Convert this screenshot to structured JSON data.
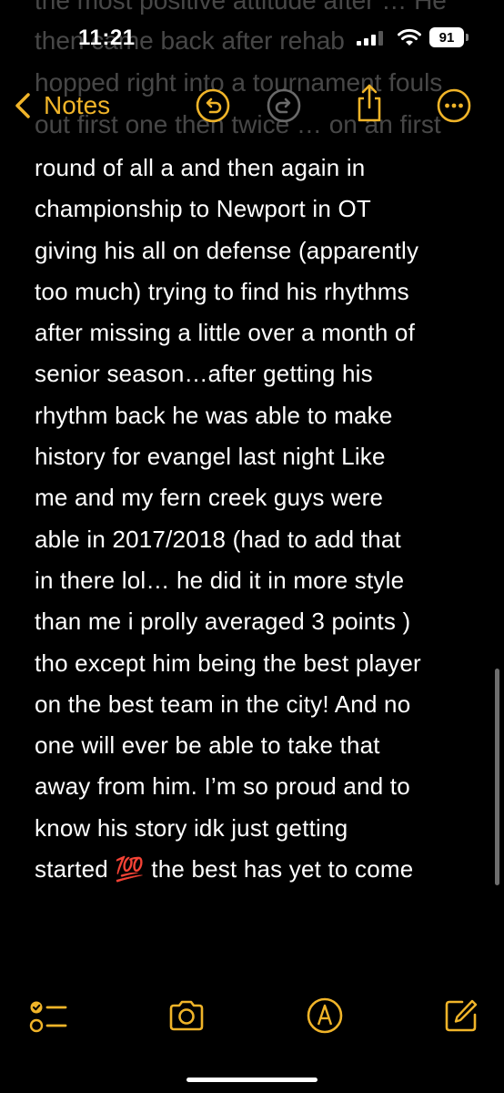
{
  "status_bar": {
    "time": "11:21",
    "battery_level": "91",
    "icons": [
      "signal-icon",
      "wifi-icon",
      "battery-icon"
    ]
  },
  "background_text": {
    "lines": [
      "the most positive attitude after … He",
      "then came back after rehab",
      "hopped right into a tournament fouls",
      "out first one then twice … on an first"
    ]
  },
  "nav": {
    "back_label": "Notes",
    "accent_color": "#f0b429",
    "icons": [
      "chevron-left-icon",
      "undo-icon",
      "redo-icon",
      "share-icon",
      "more-icon"
    ]
  },
  "note": {
    "lines": [
      "round of all a and then again in",
      "championship to Newport in OT",
      "giving his all on defense (apparently",
      "too much) trying to find his rhythms",
      "after missing a little over a month of",
      "senior season…after getting his",
      "rhythm back he was able to make",
      "history for evangel last night Like",
      "me and my fern creek guys were",
      "able in 2017/2018 (had to add that",
      "in there lol… he did it in more style",
      "than me i prolly averaged 3 points )",
      "tho except him being the best player",
      "on the best team in the city! And no",
      "one will ever be able to  take that",
      "away from him. I’m so proud and to",
      "know his story idk just getting",
      "started 💯 the best has yet to come"
    ]
  },
  "toolbar": {
    "icons": [
      "checklist-icon",
      "camera-icon",
      "markup-icon",
      "compose-icon"
    ]
  }
}
